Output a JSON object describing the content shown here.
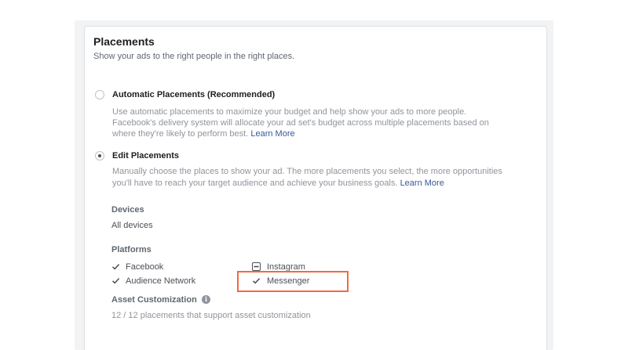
{
  "placements": {
    "title": "Placements",
    "subtitle": "Show your ads to the right people in the right places."
  },
  "automatic": {
    "label": "Automatic Placements (Recommended)",
    "desc_line1": "Use automatic placements to maximize your budget and help show your ads to more people.",
    "desc_line2": "Facebook's delivery system will allocate your ad set's budget across multiple placements based on",
    "desc_line3": "where they're likely to perform best.",
    "learn_more": "Learn More",
    "selected": false
  },
  "edit": {
    "label": "Edit Placements",
    "desc_line1": "Manually choose the places to show your ad. The more placements you select, the more opportunities",
    "desc_line2": "you'll have to reach your target audience and achieve your business goals.",
    "learn_more": "Learn More",
    "selected": true
  },
  "devices": {
    "label": "Devices",
    "value": "All devices"
  },
  "platforms": {
    "label": "Platforms",
    "items": [
      {
        "name": "Facebook",
        "state": "checked"
      },
      {
        "name": "Instagram",
        "state": "indeterminate"
      },
      {
        "name": "Audience Network",
        "state": "checked"
      },
      {
        "name": "Messenger",
        "state": "checked"
      }
    ]
  },
  "asset_customization": {
    "label": "Asset Customization",
    "info_icon": "info-icon",
    "summary": "12 / 12 placements that support asset customization"
  },
  "colors": {
    "link": "#385898",
    "highlight": "#ef6a45"
  }
}
